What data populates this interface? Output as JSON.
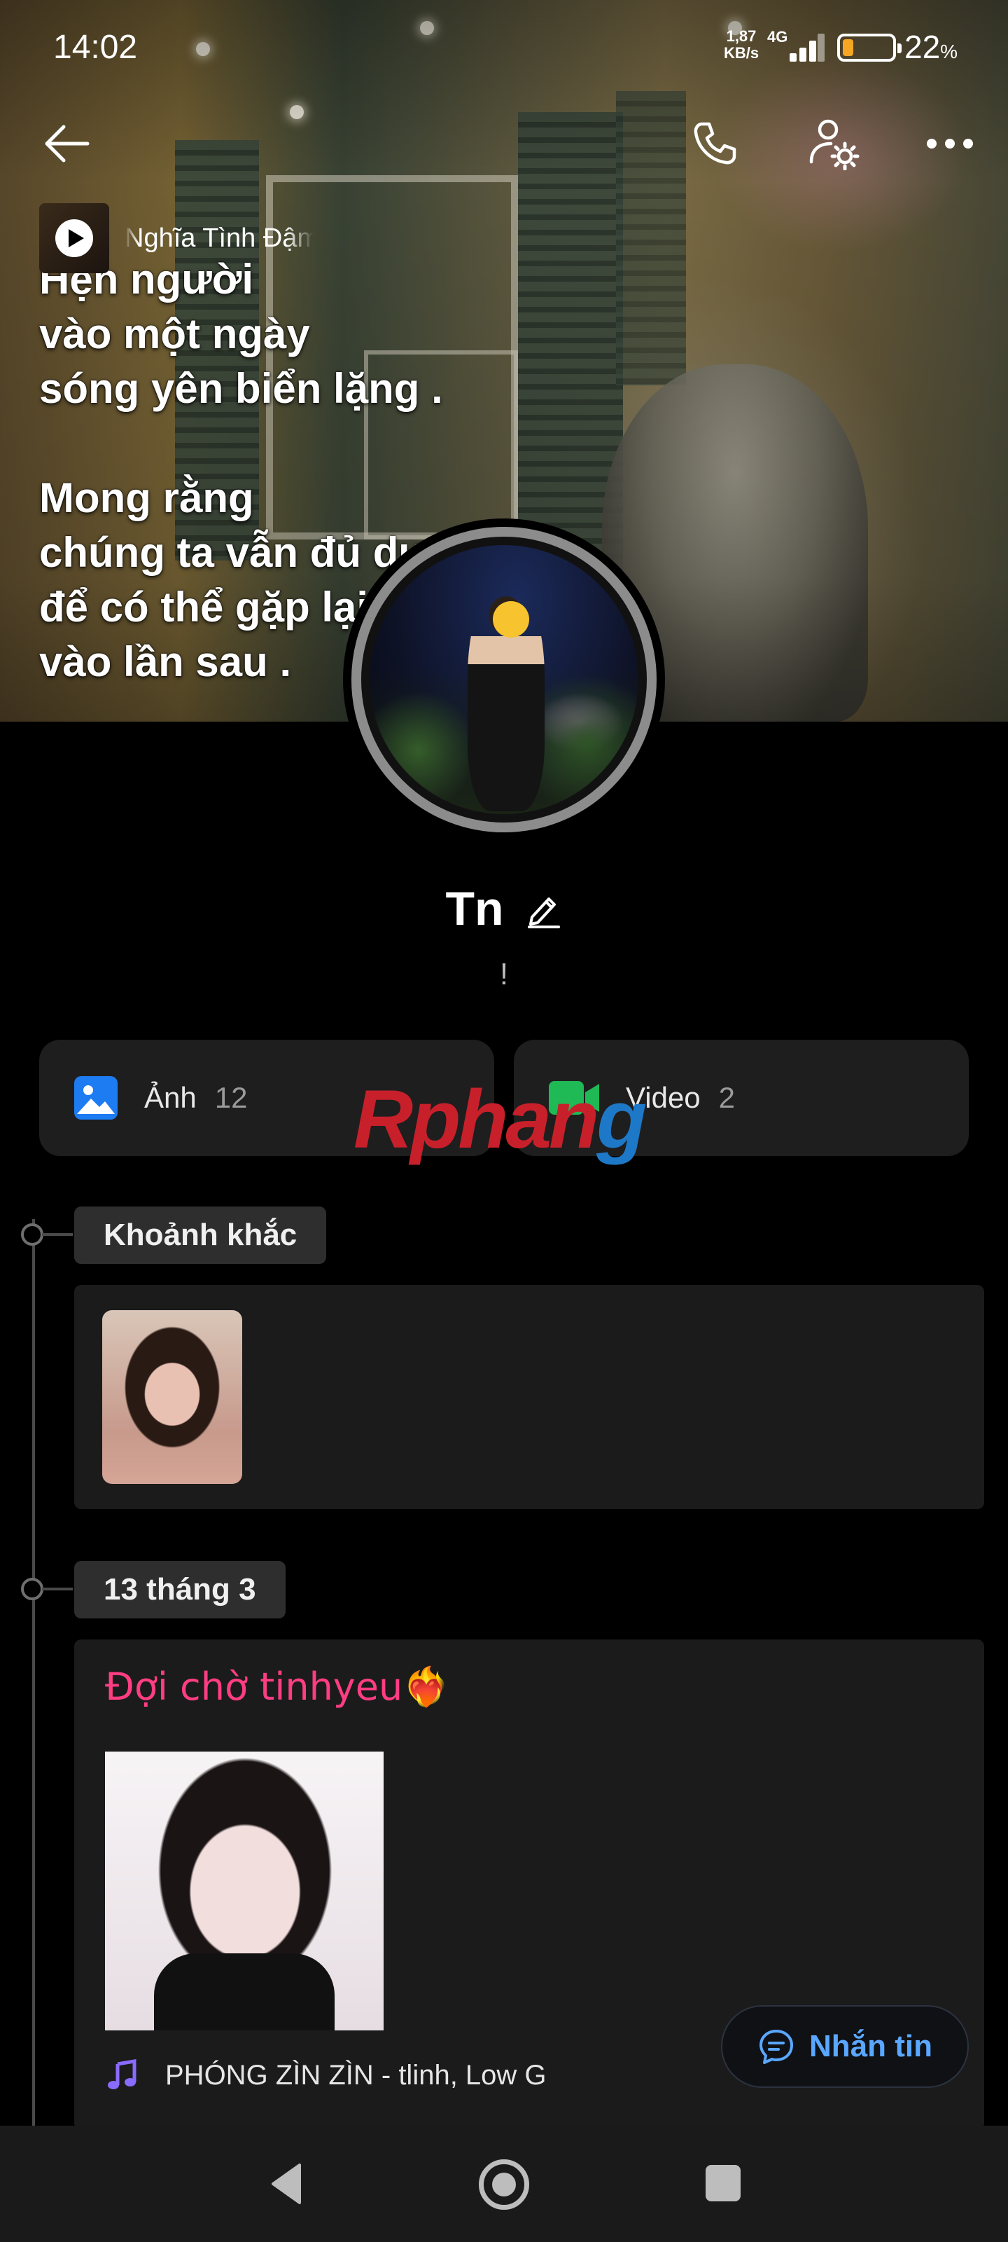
{
  "status_bar": {
    "time": "14:02",
    "net_speed_value": "1,87",
    "net_speed_unit": "KB/s",
    "network": "4G",
    "battery_percent": "22",
    "battery_symbol": "%",
    "battery_level": 0.22
  },
  "header": {
    "back_icon": "arrow-left-icon",
    "call_icon": "phone-icon",
    "settings_icon": "user-settings-icon",
    "more_icon": "more-horizontal-icon"
  },
  "cover": {
    "music_title": "Nghĩa Tình Đậm",
    "quote": "Hẹn người\nvào một ngày\nsóng yên biển lặng .\n\nMong rằng\nchúng ta vẫn đủ duyên\nđể có thể gặp lại\nvào lần sau ."
  },
  "profile": {
    "name": "Tn",
    "bio": "!"
  },
  "media": {
    "photos_label": "Ảnh",
    "photos_count": "12",
    "videos_label": "Video",
    "videos_count": "2"
  },
  "watermark": {
    "part1": "Rphan",
    "part2": "g"
  },
  "timeline": {
    "moments_label": "Khoảnh khắc",
    "date_label": "13 tháng 3",
    "post_title": "Đợi chờ tinhyeu",
    "post_emoji": "❤️‍🔥",
    "song_title": "PHÓNG ZÌN ZÌN - tlinh, Low G"
  },
  "actions": {
    "message_label": "Nhắn tin"
  },
  "colors": {
    "accent_blue": "#5aa7ff",
    "post_title_pink": "#ff3d82",
    "photo_icon_blue": "#1e7cf2",
    "video_icon_green": "#1fb955",
    "music_icon_purple": "#8a6bff"
  }
}
